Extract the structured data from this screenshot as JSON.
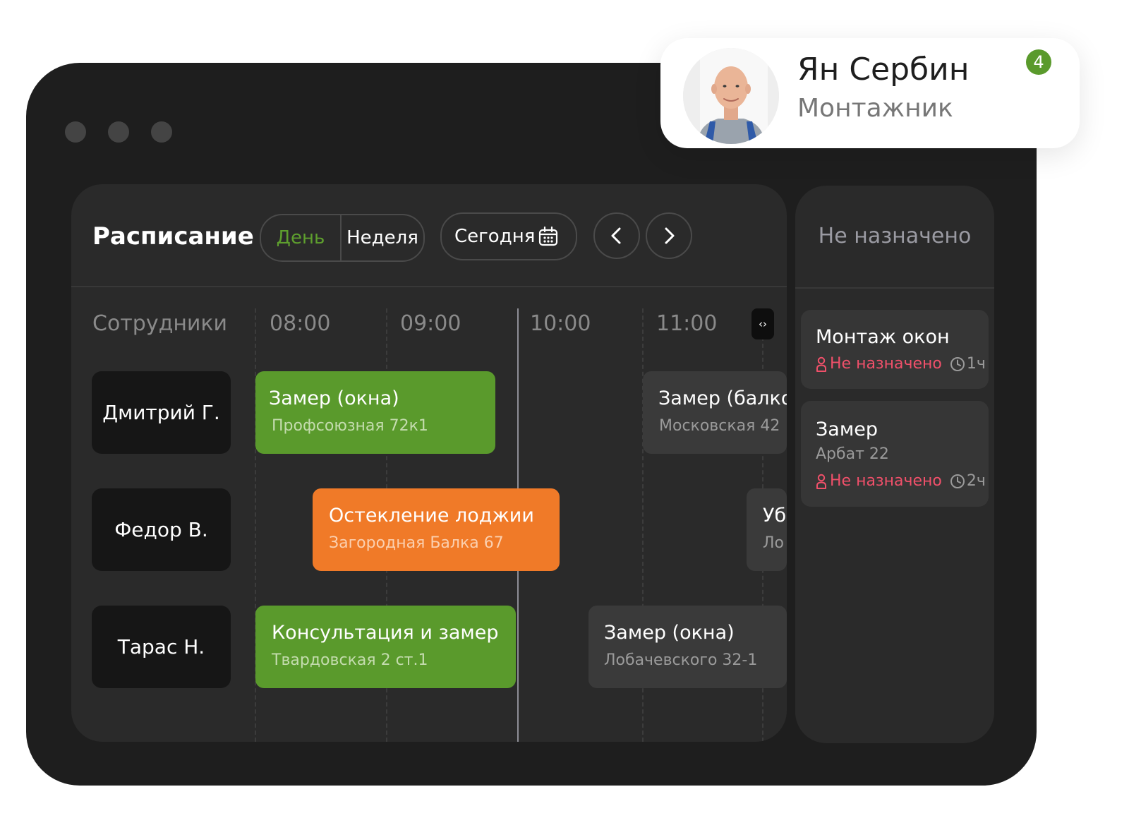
{
  "schedule": {
    "title": "Расписание",
    "view_day": "День",
    "view_week": "Неделя",
    "today": "Сегодня",
    "employees_header": "Сотрудники",
    "times": [
      "08:00",
      "09:00",
      "10:00",
      "11:00"
    ],
    "employees": [
      "Дмитрий Г.",
      "Федор В.",
      "Тарас Н."
    ],
    "events": [
      {
        "title": "Замер (окна)",
        "address": "Профсоюзная 72к1",
        "status_color": "#5a9a2c"
      },
      {
        "title": "Замер (балко",
        "address": "Московская 42"
      },
      {
        "title": "Остекление лоджии",
        "address": "Загородная Балка 67",
        "status_color": "#f07a28"
      },
      {
        "title": "Уб",
        "address": "Ло"
      },
      {
        "title": "Консультация и замер",
        "address": "Твардовская 2 ст.1",
        "status_color": "#5a9a2c"
      },
      {
        "title": "Замер (окна)",
        "address": "Лобачевского 32-1"
      }
    ]
  },
  "unassigned": {
    "title": "Не назначено",
    "tasks": [
      {
        "title": "Монтаж окон",
        "status": "Не назначено",
        "duration": "1ч"
      },
      {
        "title": "Замер",
        "address": "Арбат 22",
        "status": "Не назначено",
        "duration": "2ч"
      }
    ]
  },
  "profile": {
    "name": "Ян Сербин",
    "role": "Монтажник",
    "badge": "4"
  },
  "colors": {
    "accent_green": "#5a9a2c",
    "accent_orange": "#f07a28",
    "alert_red": "#f0506a",
    "window_bg": "#1e1e1e",
    "panel_bg": "#2a2a2a"
  }
}
